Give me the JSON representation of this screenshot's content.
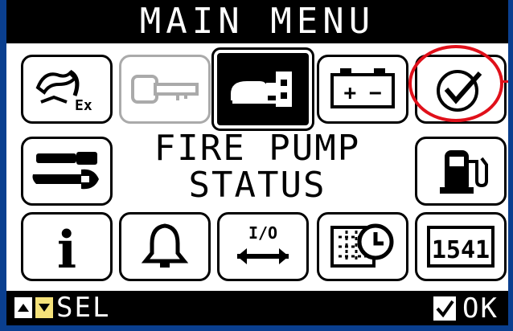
{
  "title": "MAIN MENU",
  "center_label": {
    "line1": "FIRE PUMP",
    "line2": "STATUS"
  },
  "icons": [
    {
      "name": "manual-mode-icon",
      "text": "Ex"
    },
    {
      "name": "key-icon"
    },
    {
      "name": "engine-pump-icon"
    },
    {
      "name": "battery-icon",
      "text": "+ −"
    },
    {
      "name": "check-icon"
    },
    {
      "name": "wrench-settings-icon"
    },
    {
      "name": "fuel-pump-icon"
    },
    {
      "name": "info-icon",
      "text": "i"
    },
    {
      "name": "bell-alarm-icon"
    },
    {
      "name": "io-exchange-icon",
      "text": "I/O"
    },
    {
      "name": "calendar-clock-icon"
    },
    {
      "name": "counter-icon",
      "text": "1541"
    }
  ],
  "bottom_bar": {
    "sel_label": "SEL",
    "ok_label": "OK"
  },
  "colors": {
    "background": "#0a3f8f",
    "lcd": "#ffffff",
    "bars": "#000000",
    "annotation": "#e0101a",
    "down_arrow_highlight": "#f5e27a"
  }
}
